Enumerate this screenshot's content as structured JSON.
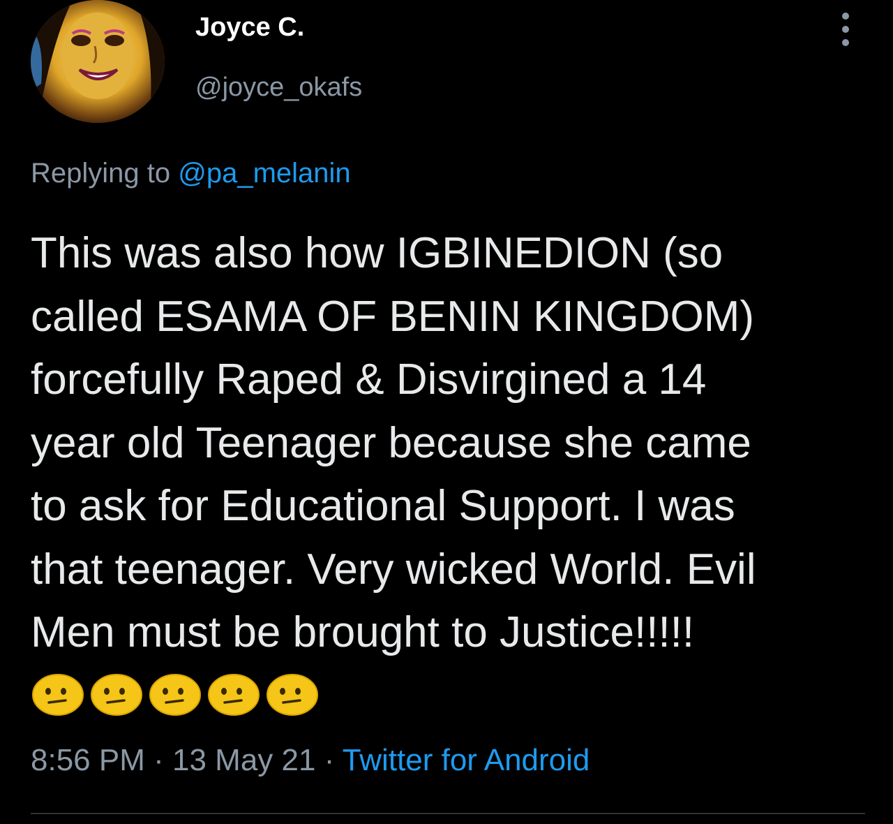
{
  "tweet": {
    "author": {
      "display_name": "Joyce C.",
      "handle": "@joyce_okafs"
    },
    "reply": {
      "prefix": "Replying to",
      "mention": "@pa_melanin"
    },
    "text_lines": [
      "This was also how IGBINEDION (so",
      "called ESAMA OF BENIN KINGDOM)",
      "forcefully Raped & Disvirgined a 14",
      "year old Teenager because she came",
      "to ask for Educational Support. I was",
      "that teenager. Very wicked World. Evil",
      "Men must be brought to Justice!!!!!"
    ],
    "emojis": [
      "confused-face",
      "confused-face",
      "confused-face",
      "confused-face",
      "confused-face"
    ],
    "meta": {
      "time": "8:56 PM",
      "separator": "·",
      "date": "13 May 21",
      "source": "Twitter for Android"
    }
  },
  "icons": {
    "more": "more-vertical-icon"
  },
  "colors": {
    "background": "#000000",
    "text": "#e7e9ea",
    "secondary": "#8b98a5",
    "accent": "#1d9bf0",
    "emoji": "#f5c518"
  }
}
